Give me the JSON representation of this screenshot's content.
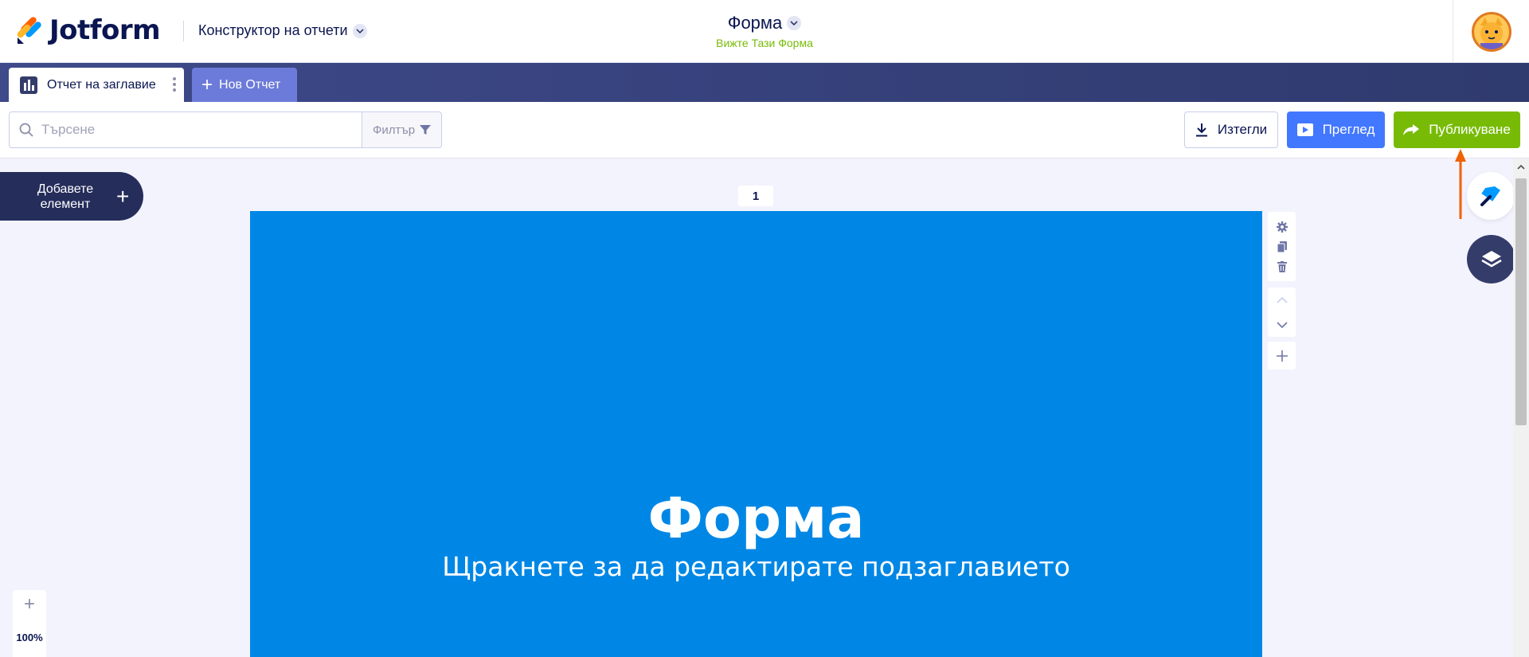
{
  "header": {
    "logo_text": "Jotform",
    "builder_switch": "Конструктор на отчети",
    "form_title": "Форма",
    "form_subtitle": "Вижте Тази Форма"
  },
  "tabs": {
    "active_label": "Отчет на заглавие",
    "new_label": "Нов Отчет"
  },
  "toolbar": {
    "search_placeholder": "Търсене",
    "filter_label": "Филтър",
    "download_label": "Изтегли",
    "preview_label": "Преглед",
    "publish_label": "Публикуване"
  },
  "canvas": {
    "add_element_label": "Добавете елемент",
    "page_number": "1",
    "title": "Форма",
    "subtitle": "Щракнете за да редактирате подзаглавието",
    "zoom_level": "100%"
  },
  "colors": {
    "page_background": "#0087e5",
    "publish_button": "#78bb07",
    "preview_button": "#4277ff",
    "navy": "#0a1551",
    "annotation_arrow": "#f06200"
  }
}
